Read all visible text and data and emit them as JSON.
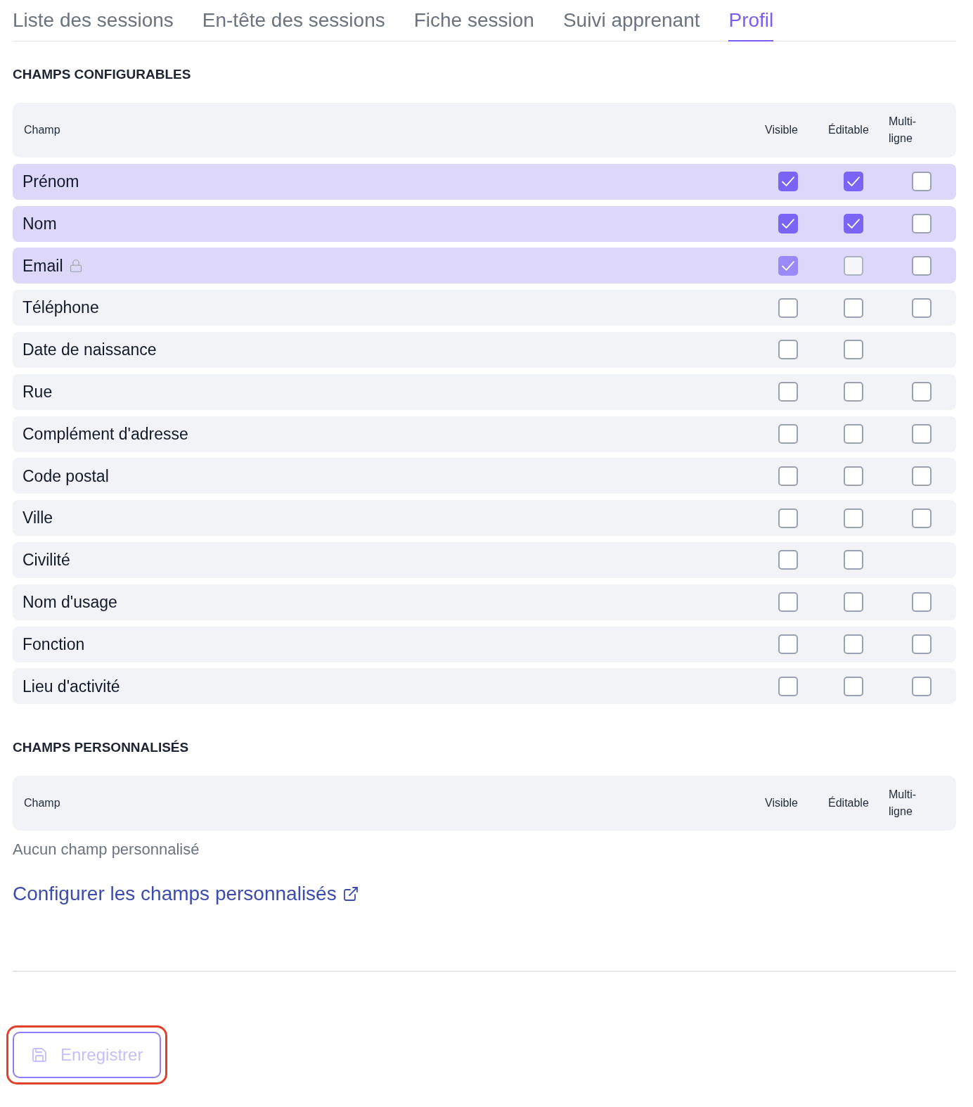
{
  "tabs": [
    {
      "label": "Liste des sessions",
      "selected": false
    },
    {
      "label": "En-tête des sessions",
      "selected": false
    },
    {
      "label": "Fiche session",
      "selected": false
    },
    {
      "label": "Suivi apprenant",
      "selected": false
    },
    {
      "label": "Profil",
      "selected": true
    }
  ],
  "sections": [
    {
      "title": "CHAMPS CONFIGURABLES",
      "columns": [
        "Champ",
        "Visible",
        "Éditable",
        "Multi-ligne"
      ],
      "rows": [
        {
          "label": "Prénom",
          "selected": true,
          "locked": false,
          "visible": {
            "checked": true,
            "disabled": false
          },
          "editable": {
            "checked": true,
            "disabled": false
          },
          "multiline": {
            "checked": false,
            "disabled": false
          }
        },
        {
          "label": "Nom",
          "selected": true,
          "locked": false,
          "visible": {
            "checked": true,
            "disabled": false
          },
          "editable": {
            "checked": true,
            "disabled": false
          },
          "multiline": {
            "checked": false,
            "disabled": false
          }
        },
        {
          "label": "Email",
          "selected": true,
          "locked": true,
          "visible": {
            "checked": true,
            "disabled": true
          },
          "editable": {
            "checked": false,
            "disabled": true
          },
          "multiline": {
            "checked": false,
            "disabled": false
          }
        },
        {
          "label": "Téléphone",
          "selected": false,
          "locked": false,
          "visible": {
            "checked": false,
            "disabled": false
          },
          "editable": {
            "checked": false,
            "disabled": false
          },
          "multiline": {
            "checked": false,
            "disabled": false
          }
        },
        {
          "label": "Date de naissance",
          "selected": false,
          "locked": false,
          "visible": {
            "checked": false,
            "disabled": false
          },
          "editable": {
            "checked": false,
            "disabled": false
          }
        },
        {
          "label": "Rue",
          "selected": false,
          "locked": false,
          "visible": {
            "checked": false,
            "disabled": false
          },
          "editable": {
            "checked": false,
            "disabled": false
          },
          "multiline": {
            "checked": false,
            "disabled": false
          }
        },
        {
          "label": "Complément d'adresse",
          "selected": false,
          "locked": false,
          "visible": {
            "checked": false,
            "disabled": false
          },
          "editable": {
            "checked": false,
            "disabled": false
          },
          "multiline": {
            "checked": false,
            "disabled": false
          }
        },
        {
          "label": "Code postal",
          "selected": false,
          "locked": false,
          "visible": {
            "checked": false,
            "disabled": false
          },
          "editable": {
            "checked": false,
            "disabled": false
          },
          "multiline": {
            "checked": false,
            "disabled": false
          }
        },
        {
          "label": "Ville",
          "selected": false,
          "locked": false,
          "visible": {
            "checked": false,
            "disabled": false
          },
          "editable": {
            "checked": false,
            "disabled": false
          },
          "multiline": {
            "checked": false,
            "disabled": false
          }
        },
        {
          "label": "Civilité",
          "selected": false,
          "locked": false,
          "visible": {
            "checked": false,
            "disabled": false
          },
          "editable": {
            "checked": false,
            "disabled": false
          }
        },
        {
          "label": "Nom d'usage",
          "selected": false,
          "locked": false,
          "visible": {
            "checked": false,
            "disabled": false
          },
          "editable": {
            "checked": false,
            "disabled": false
          },
          "multiline": {
            "checked": false,
            "disabled": false
          }
        },
        {
          "label": "Fonction",
          "selected": false,
          "locked": false,
          "visible": {
            "checked": false,
            "disabled": false
          },
          "editable": {
            "checked": false,
            "disabled": false
          },
          "multiline": {
            "checked": false,
            "disabled": false
          }
        },
        {
          "label": "Lieu d'activité",
          "selected": false,
          "locked": false,
          "visible": {
            "checked": false,
            "disabled": false
          },
          "editable": {
            "checked": false,
            "disabled": false
          },
          "multiline": {
            "checked": false,
            "disabled": false
          }
        }
      ]
    },
    {
      "title": "CHAMPS PERSONNALISÉS",
      "columns": [
        "Champ",
        "Visible",
        "Éditable",
        "Multi-ligne"
      ],
      "empty_message": "Aucun champ personnalisé",
      "link": "Configurer les champs personnalisés"
    }
  ],
  "save_button": {
    "label": "Enregistrer",
    "disabled": true,
    "highlighted": true
  }
}
